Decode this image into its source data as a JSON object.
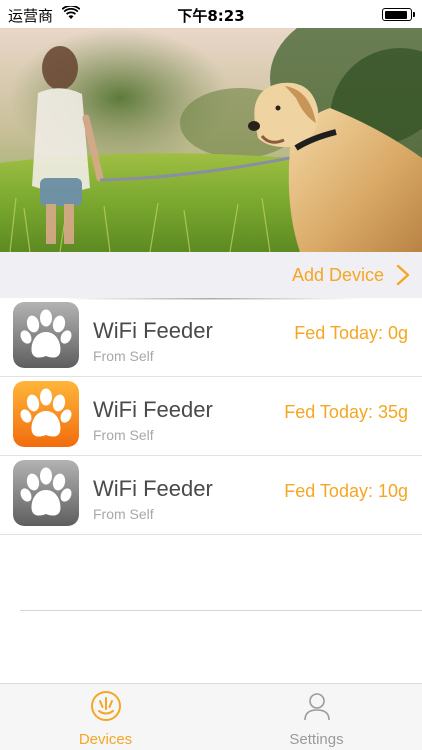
{
  "status_bar": {
    "carrier": "运营商",
    "time": "下午8:23",
    "battery_level": 0.95
  },
  "hero": {
    "image": "girl-walking-golden-retriever-photo"
  },
  "add_device": {
    "label": "Add Device",
    "icon": "chevron-right-icon"
  },
  "devices": [
    {
      "name": "WiFi Feeder",
      "source": "From Self",
      "fed": "Fed Today: 0g",
      "icon": "paw-icon",
      "icon_color": "gray"
    },
    {
      "name": "WiFi Feeder",
      "source": "From Self",
      "fed": "Fed Today: 35g",
      "icon": "paw-icon",
      "icon_color": "orange"
    },
    {
      "name": "WiFi Feeder",
      "source": "From Self",
      "fed": "Fed Today: 10g",
      "icon": "paw-icon",
      "icon_color": "gray"
    }
  ],
  "tab_bar": {
    "tabs": [
      {
        "label": "Devices",
        "icon": "feeder-bowl-icon",
        "active": true
      },
      {
        "label": "Settings",
        "icon": "person-icon",
        "active": false
      }
    ]
  },
  "colors": {
    "accent": "#f5a623",
    "list_background": "#efeff4",
    "text_primary": "#4a4a4a",
    "text_secondary": "#a8a8a8"
  }
}
